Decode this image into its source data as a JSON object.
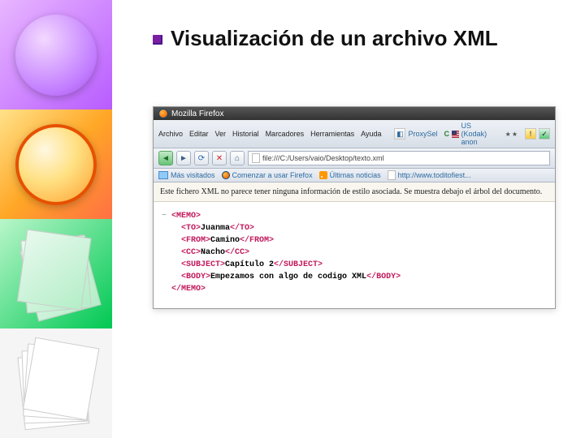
{
  "slide": {
    "title": "Visualización de un archivo XML"
  },
  "browser": {
    "app_name": "Mozilla Firefox",
    "menus": {
      "archivo": "Archivo",
      "editar": "Editar",
      "ver": "Ver",
      "historial": "Historial",
      "marcadores": "Marcadores",
      "herramientas": "Herramientas",
      "ayuda": "Ayuda"
    },
    "plugins": {
      "proxysel": "ProxySel",
      "anonlabel": "US (Kodak) anon"
    },
    "url": "file:///C:/Users/vaio/Desktop/texto.xml",
    "bookmarks": {
      "most_visited": "Más visitados",
      "getting_started": "Comenzar a usar Firefox",
      "latest_news": "Últimas noticias",
      "site1": "http://www.toditofiest..."
    },
    "warning": "Este fichero XML no parece tener ninguna información de estilo asociada. Se muestra debajo el árbol del documento."
  },
  "xml": {
    "toggle": "−",
    "root_open": "<MEMO>",
    "to_open": "<TO>",
    "to_text": "Juanma",
    "to_close": "</TO>",
    "from_open": "<FROM>",
    "from_text": "Camino",
    "from_close": "</FROM>",
    "cc_open": "<CC>",
    "cc_text": "Nacho",
    "cc_close": "</CC>",
    "subject_open": "<SUBJECT>",
    "subject_text": "Capítulo 2",
    "subject_close": "</SUBJECT>",
    "body_open": "<BODY>",
    "body_text": "Empezamos con algo de codigo XML",
    "body_close": "</BODY>",
    "root_close": "</MEMO>"
  }
}
